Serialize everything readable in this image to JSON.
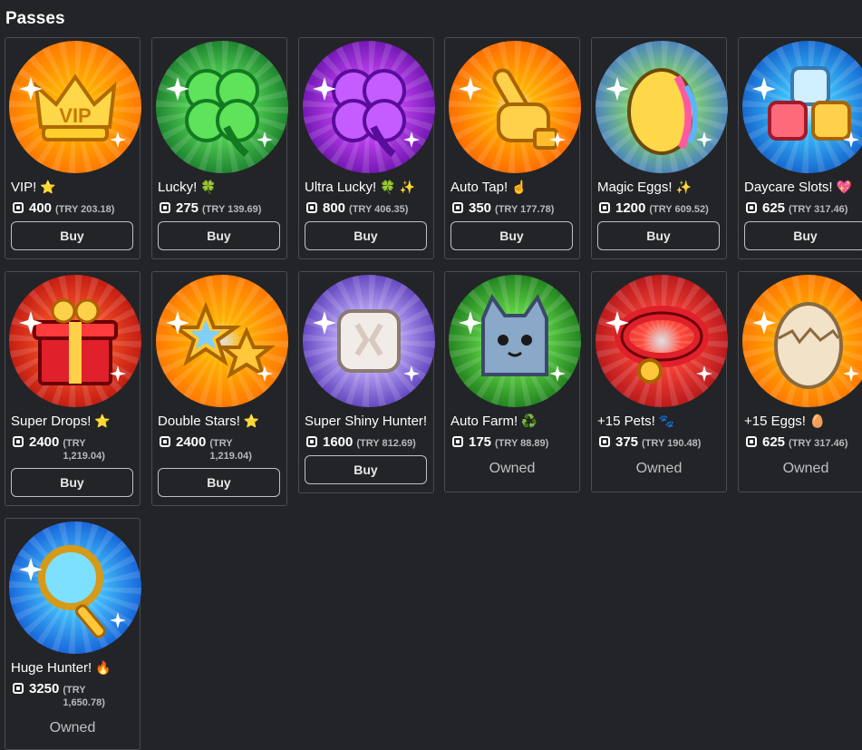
{
  "section_title": "Passes",
  "currency_icon": "robux-icon",
  "buy_label": "Buy",
  "owned_label": "Owned",
  "passes": [
    {
      "id": "vip",
      "name": "VIP!",
      "emoji": "⭐",
      "price": "400",
      "local_price": "(TRY 203.18)",
      "status": "buy",
      "colors": [
        "#ffb300",
        "#ff6a00"
      ],
      "icon": "crown-icon"
    },
    {
      "id": "lucky",
      "name": "Lucky!",
      "emoji": "🍀",
      "price": "275",
      "local_price": "(TRY 139.69)",
      "status": "buy",
      "colors": [
        "#5de35b",
        "#0d6b24"
      ],
      "icon": "clover-icon"
    },
    {
      "id": "ultra-lucky",
      "name": "Ultra Lucky!",
      "emoji": "🍀 ✨",
      "price": "800",
      "local_price": "(TRY 406.35)",
      "status": "buy",
      "colors": [
        "#d24dff",
        "#5a0aa0"
      ],
      "icon": "purple-clover-icon"
    },
    {
      "id": "auto-tap",
      "name": "Auto Tap!",
      "emoji": "☝",
      "price": "350",
      "local_price": "(TRY 177.78)",
      "status": "buy",
      "colors": [
        "#ffb300",
        "#ff5a00"
      ],
      "icon": "pointing-hand-icon"
    },
    {
      "id": "magic-eggs",
      "name": "Magic Eggs!",
      "emoji": "✨",
      "price": "1200",
      "local_price": "(TRY 609.52)",
      "status": "buy",
      "colors": [
        "#8ee85a",
        "#3a6ad6"
      ],
      "icon": "rainbow-egg-icon"
    },
    {
      "id": "daycare-slots",
      "name": "Daycare Slots!",
      "emoji": "💖",
      "price": "625",
      "local_price": "(TRY 317.46)",
      "status": "buy",
      "colors": [
        "#3fc6ff",
        "#0b4fc2"
      ],
      "icon": "dice-blocks-icon"
    },
    {
      "id": "super-drops",
      "name": "Super Drops!",
      "emoji": "⭐",
      "price": "2400",
      "local_price": "(TRY 1,219.04)",
      "status": "buy",
      "colors": [
        "#ff5a2a",
        "#b30c0c"
      ],
      "icon": "gift-box-icon"
    },
    {
      "id": "double-stars",
      "name": "Double Stars!",
      "emoji": "⭐",
      "price": "2400",
      "local_price": "(TRY 1,219.04)",
      "status": "buy",
      "colors": [
        "#ffb300",
        "#ff6a00"
      ],
      "icon": "stars-icon"
    },
    {
      "id": "super-shiny-hunter",
      "name": "Super Shiny Hunter!",
      "emoji": "",
      "price": "1600",
      "local_price": "(TRY 812.69)",
      "status": "buy",
      "colors": [
        "#c9b8ff",
        "#4a2ab0"
      ],
      "icon": "shiny-cube-icon"
    },
    {
      "id": "auto-farm",
      "name": "Auto Farm!",
      "emoji": "♻️",
      "price": "175",
      "local_price": "(TRY 88.89)",
      "status": "owned",
      "colors": [
        "#6be34a",
        "#0f6a16"
      ],
      "icon": "cat-pet-icon"
    },
    {
      "id": "plus-15-pets",
      "name": "+15 Pets!",
      "emoji": "🐾",
      "price": "375",
      "local_price": "(TRY 190.48)",
      "status": "owned",
      "colors": [
        "#ff4a3a",
        "#a80c14"
      ],
      "icon": "collar-icon"
    },
    {
      "id": "plus-15-eggs",
      "name": "+15 Eggs!",
      "emoji": "🥚",
      "price": "625",
      "local_price": "(TRY 317.46)",
      "status": "owned",
      "colors": [
        "#ffb300",
        "#ff6a00"
      ],
      "icon": "cracked-egg-icon"
    },
    {
      "id": "huge-hunter",
      "name": "Huge Hunter!",
      "emoji": "🔥",
      "price": "3250",
      "local_price": "(TRY 1,650.78)",
      "status": "owned",
      "colors": [
        "#49c8ff",
        "#0a4cd0"
      ],
      "icon": "magnifier-icon"
    }
  ]
}
